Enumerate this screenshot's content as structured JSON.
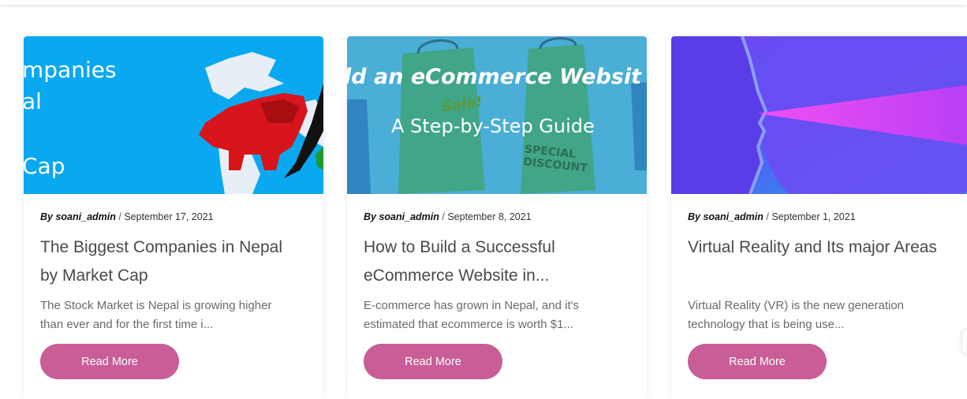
{
  "posts": [
    {
      "thumb_text": [
        "mpanies",
        "al",
        "Cap"
      ],
      "author": "soani_admin",
      "by": "By",
      "date": "September 17, 2021",
      "title": "The Biggest Companies in Nepal by Market Cap",
      "excerpt": "The Stock Market is Nepal is growing higher than ever and for the first time i...",
      "button": "Read More"
    },
    {
      "thumb_text": [
        "ld an eCommerce Websit",
        "Sale!",
        "A Step-by-Step Guide",
        "SPECIAL DISCOUNT"
      ],
      "author": "soani_admin",
      "by": "By",
      "date": "September 8, 2021",
      "title": "How to Build a Successful eCommerce Website in...",
      "excerpt": "E-commerce has grown in Nepal, and it's estimated that ecommerce is worth $1...",
      "button": "Read More"
    },
    {
      "author": "soani_admin",
      "by": "By",
      "date": "September 1, 2021",
      "title": "Virtual Reality and Its major Areas",
      "excerpt": "Virtual Reality (VR) is the new generation technology that is being use...",
      "button": "Read More"
    }
  ],
  "colors": {
    "button": "#c95d97",
    "thumb1_bg": "#0aa8f0",
    "thumb2_bg": "#4aaed6",
    "thumb3_bg": "#5b4cf0"
  }
}
